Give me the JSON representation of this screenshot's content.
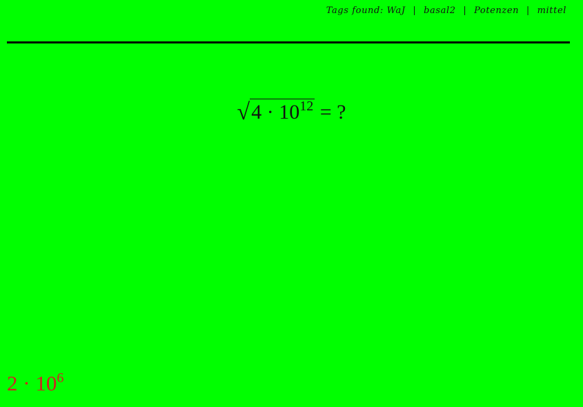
{
  "header": {
    "tags_prefix": "Tags found:",
    "tags": [
      "WaJ",
      "basal2",
      "Potenzen",
      "mittel"
    ],
    "separator": "|"
  },
  "question": {
    "radical_sign": "√",
    "base_expr": "4 · 10",
    "exponent": "12",
    "tail": " = ?"
  },
  "answer": {
    "base_expr": "2 · 10",
    "exponent": "6",
    "color": "#d42020"
  },
  "colors": {
    "background": "#00ff00",
    "rule": "#000000",
    "text": "#111111"
  }
}
